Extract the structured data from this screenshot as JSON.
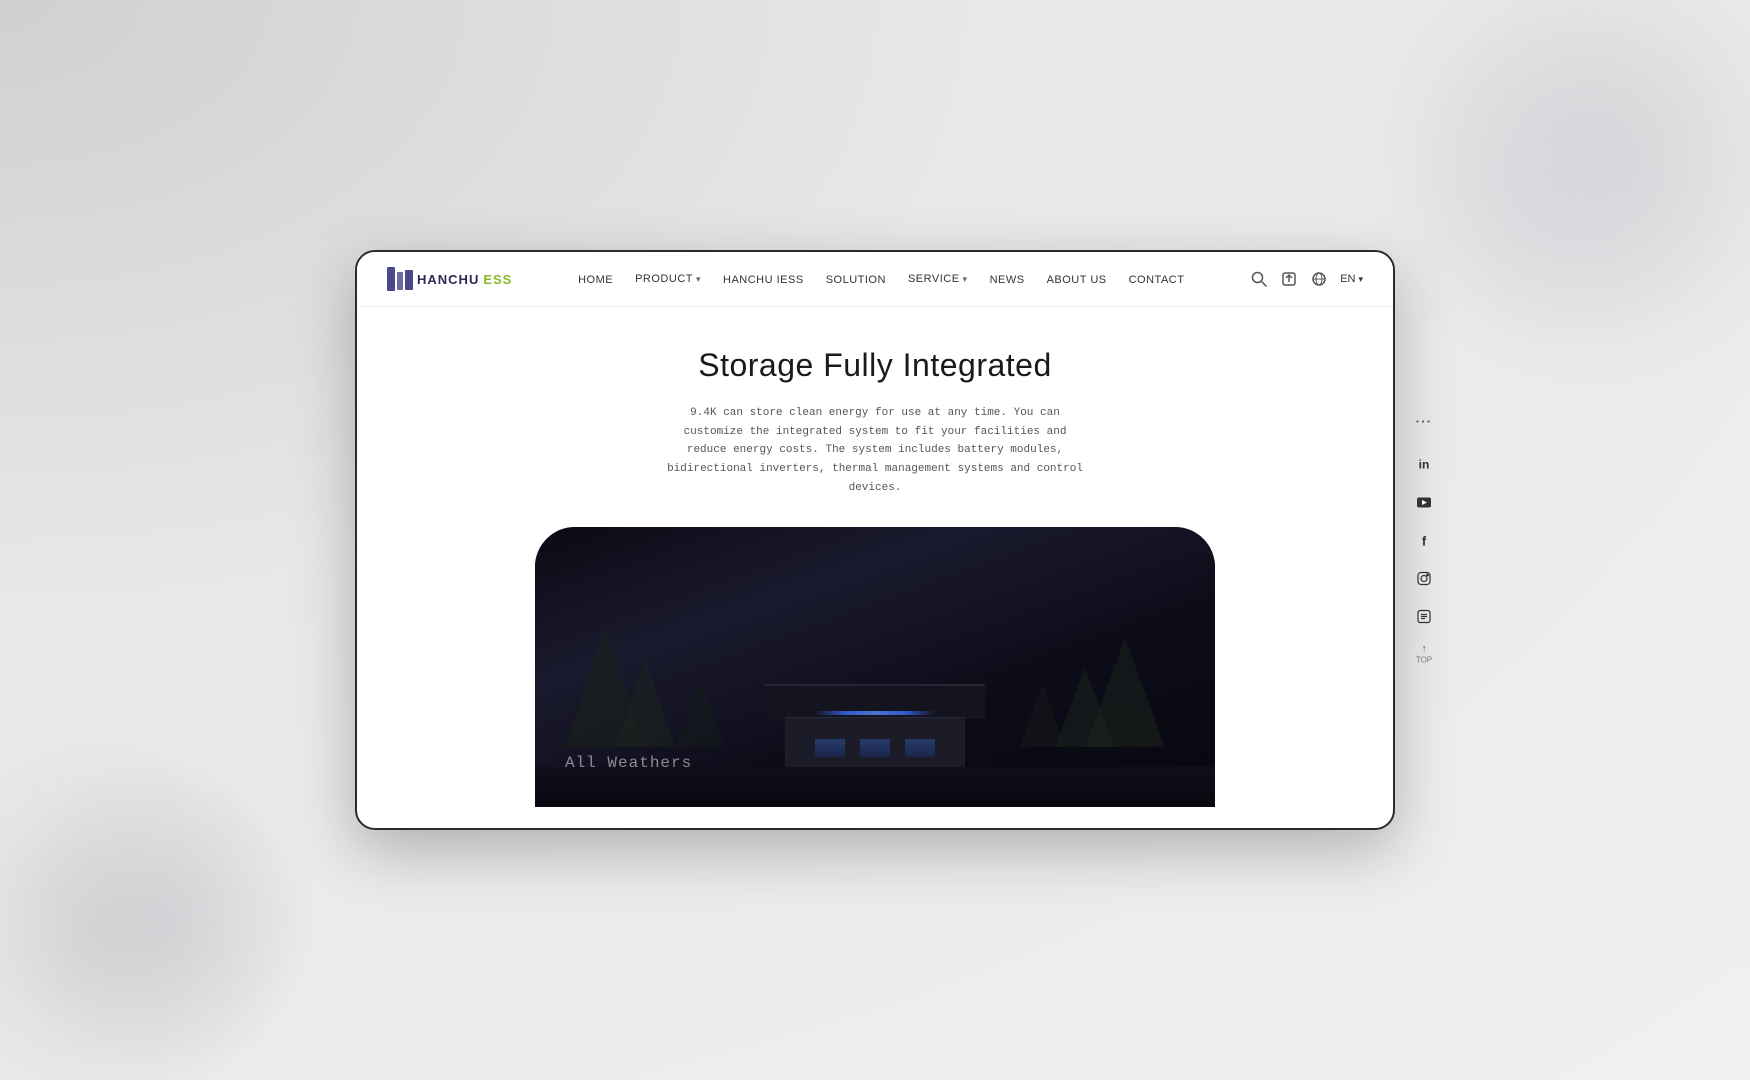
{
  "browser": {
    "title": "Hanchu ESS"
  },
  "navbar": {
    "logo": {
      "text_hanchu": "HANCHU",
      "text_iess": "ESS"
    },
    "links": [
      {
        "label": "HOME",
        "has_dropdown": false
      },
      {
        "label": "PRODUCT",
        "has_dropdown": true
      },
      {
        "label": "HANCHU IESS",
        "has_dropdown": false
      },
      {
        "label": "SOLUTION",
        "has_dropdown": false
      },
      {
        "label": "SERVICE",
        "has_dropdown": true
      },
      {
        "label": "NEWS",
        "has_dropdown": false
      },
      {
        "label": "ABOUT US",
        "has_dropdown": false
      },
      {
        "label": "CONTACT",
        "has_dropdown": false
      }
    ],
    "language": "EN"
  },
  "hero": {
    "title": "Storage Fully Integrated",
    "description": "9.4K can store clean energy for use at any time. You can customize the integrated system to fit your facilities and reduce energy costs. The system includes battery modules, bidirectional inverters, thermal management systems and control devices."
  },
  "image_overlay": {
    "text": "All Weathers"
  },
  "social": {
    "icons": [
      {
        "name": "linkedin-icon",
        "symbol": "in"
      },
      {
        "name": "youtube-icon",
        "symbol": "▶"
      },
      {
        "name": "facebook-icon",
        "symbol": "f"
      },
      {
        "name": "instagram-icon",
        "symbol": "◎"
      },
      {
        "name": "youtube2-icon",
        "symbol": "⊡"
      },
      {
        "name": "top-arrow-icon",
        "symbol": "↑"
      }
    ]
  },
  "colors": {
    "accent_blue": "#4a4a8a",
    "accent_green": "#8aba2a",
    "dark_bg": "#0a0a14",
    "navbar_bg": "#ffffff",
    "text_dark": "#1a1a1a",
    "text_gray": "#555555"
  }
}
